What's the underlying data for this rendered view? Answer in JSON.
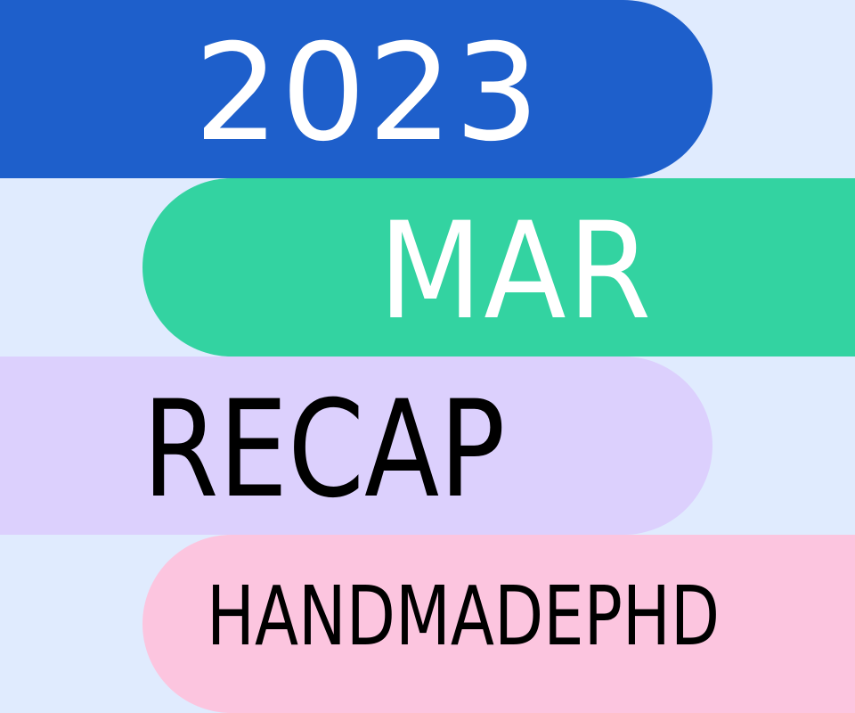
{
  "year": "2023",
  "month": "MAR",
  "title": "RECAP",
  "brand": "HANDMADEPHD",
  "colors": {
    "background": "#e0ebfe",
    "year_band": "#1e5fcb",
    "month_band": "#33d3a1",
    "recap_band": "#dcd0fd",
    "brand_band": "#fcc5df",
    "light_text": "#ffffff",
    "dark_text": "#000000"
  }
}
